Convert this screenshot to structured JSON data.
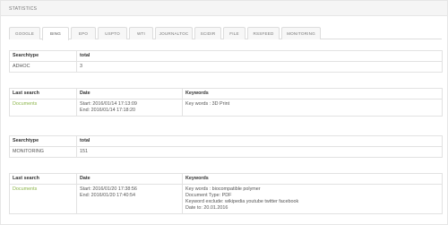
{
  "panel": {
    "title": "STATISTICS"
  },
  "tabs": [
    {
      "label": "GOOGLE",
      "active": false
    },
    {
      "label": "BING",
      "active": true
    },
    {
      "label": "EPO",
      "active": false
    },
    {
      "label": "USPTO",
      "active": false
    },
    {
      "label": "WTI",
      "active": false
    },
    {
      "label": "JOURNALTOC",
      "active": false
    },
    {
      "label": "SCIDIR",
      "active": false
    },
    {
      "label": "FILE",
      "active": false
    },
    {
      "label": "RSSFEED",
      "active": false
    },
    {
      "label": "MONITORING",
      "active": false
    }
  ],
  "adhoc": {
    "headers": {
      "searchtype": "Searchtype",
      "total": "total"
    },
    "row": {
      "searchtype": "ADHOC",
      "total": "3"
    }
  },
  "adhoc_last": {
    "headers": {
      "last_search": "Last search",
      "date": "Date",
      "keywords": "Keywords"
    },
    "row": {
      "link": "Documents",
      "start": "Start: 2016/01/14 17:13:09",
      "end": "End: 2016/01/14 17:18:20",
      "keywords": [
        "Key words : 3D Print"
      ]
    }
  },
  "monitoring": {
    "headers": {
      "searchtype": "Searchtype",
      "total": "total"
    },
    "row": {
      "searchtype": "MONITORING",
      "total": "151"
    }
  },
  "monitoring_last": {
    "headers": {
      "last_search": "Last search",
      "date": "Date",
      "keywords": "Keywords"
    },
    "row": {
      "link": "Documents",
      "start": "Start: 2016/01/20 17:38:56",
      "end": "End: 2016/01/20 17:40:54",
      "keywords": [
        "Key words : biocompatible polymer",
        "Document Type: PDF",
        "Keyword exclude: wikipedia youtube twitter facebook",
        "Date to: 20.01.2016"
      ]
    }
  },
  "colors": {
    "link": "#8cb54b",
    "border": "#e2e2e2",
    "header_bg": "#f5f5f5"
  }
}
